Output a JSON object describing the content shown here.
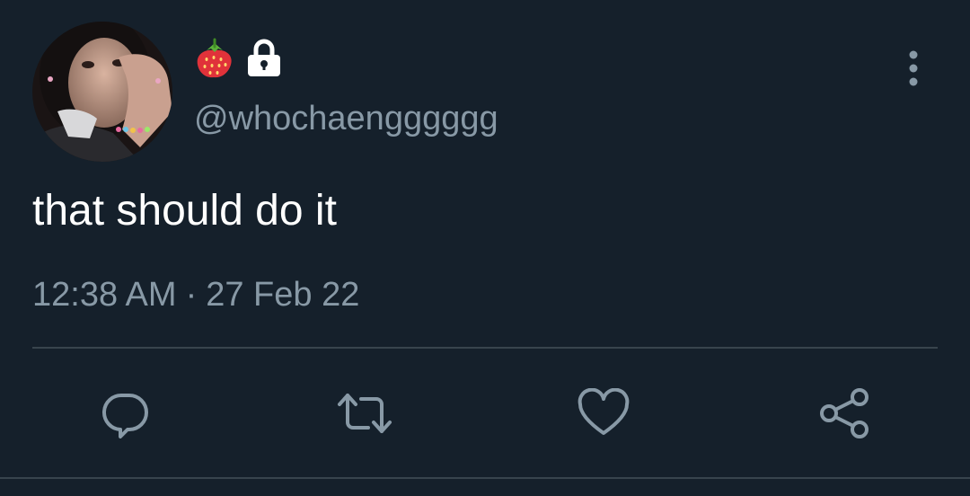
{
  "tweet": {
    "name_emoji": "strawberry-emoji",
    "lock_icon": "lock-icon",
    "handle": "@whochaengggggg",
    "text": "that should do it",
    "time": "12:38 AM",
    "separator": "·",
    "date": "27 Feb 22"
  },
  "actions": {
    "reply_icon": "reply-icon",
    "retweet_icon": "retweet-icon",
    "like_icon": "heart-icon",
    "share_icon": "share-icon"
  },
  "colors": {
    "background": "#15202b",
    "text_primary": "#ffffff",
    "text_secondary": "#8899a6",
    "divider": "#38444d"
  }
}
